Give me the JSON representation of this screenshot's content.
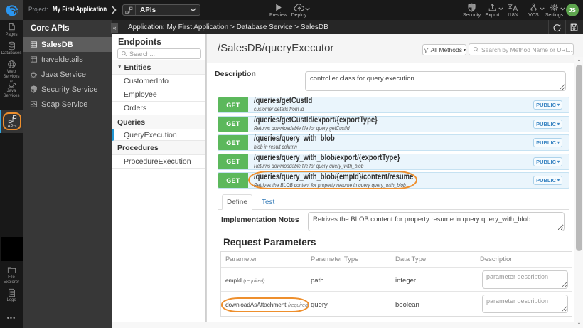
{
  "topbar": {
    "project_label": "Project:",
    "project_name": "My First Application",
    "selector_value": "APIs",
    "actions_left": [
      {
        "label": "Preview",
        "icon": "play-icon",
        "caret": false
      },
      {
        "label": "Deploy",
        "icon": "cloud-upload-icon",
        "caret": true
      }
    ],
    "actions_right": [
      {
        "label": "Security",
        "icon": "shield-icon",
        "caret": false
      },
      {
        "label": "Export",
        "icon": "export-icon",
        "caret": true
      },
      {
        "label": "I18N",
        "icon": "translate-icon",
        "caret": false
      },
      {
        "label": "VCS",
        "icon": "branch-icon",
        "caret": true
      },
      {
        "label": "Settings",
        "icon": "gear-icon",
        "caret": true
      }
    ],
    "avatar_initials": "JS"
  },
  "rail": {
    "top_items": [
      {
        "label": "Pages",
        "icon": "pages-icon",
        "active": false
      },
      {
        "label": "Databases",
        "icon": "database-icon",
        "active": false
      },
      {
        "label": "Web Services",
        "icon": "globe-icon",
        "active": false
      },
      {
        "label": "Java Services",
        "icon": "coffee-icon",
        "active": false
      },
      {
        "label": "APIs",
        "icon": "api-icon",
        "active": true
      }
    ],
    "bottom_items": [
      {
        "label": "File Explorer",
        "icon": "folder-icon"
      },
      {
        "label": "Logs",
        "icon": "logs-icon"
      }
    ],
    "more_label": "•••"
  },
  "core_apis": {
    "title": "Core APIs",
    "collapse_label": "«",
    "items": [
      {
        "label": "SalesDB",
        "icon": "table-icon",
        "selected": true
      },
      {
        "label": "traveldetails",
        "icon": "table-icon",
        "selected": false
      },
      {
        "label": "Java Service",
        "icon": "coffee-icon",
        "selected": false
      },
      {
        "label": "Security Service",
        "icon": "shield-icon",
        "selected": false
      },
      {
        "label": "Soap Service",
        "icon": "soap-icon",
        "selected": false
      }
    ]
  },
  "appbar": {
    "breadcrumb": "Application: My First Application > Database Service > SalesDB"
  },
  "endpoints": {
    "title": "Endpoints",
    "search_placeholder": "Search...",
    "rows": [
      {
        "type": "header",
        "label": "Entities",
        "arrow": true
      },
      {
        "type": "item",
        "label": "CustomerInfo",
        "selected": false
      },
      {
        "type": "item",
        "label": "Employee",
        "selected": false
      },
      {
        "type": "item",
        "label": "Orders",
        "selected": false
      },
      {
        "type": "header",
        "label": "Queries",
        "arrow": false
      },
      {
        "type": "item",
        "label": "QueryExecution",
        "selected": true
      },
      {
        "type": "header",
        "label": "Procedures",
        "arrow": false
      },
      {
        "type": "item",
        "label": "ProcedureExecution",
        "selected": false
      }
    ]
  },
  "main": {
    "title": "/SalesDB/queryExecutor",
    "filter_button_label": "All Methods",
    "search_placeholder": "Search by Method Name or URL...",
    "description_label": "Description",
    "description_value": "controller class for query execution",
    "methods": [
      {
        "verb": "GET",
        "path": "/queries/getCustId",
        "summary": "customer details from id",
        "visibility": "PUBLIC",
        "annotated": false
      },
      {
        "verb": "GET",
        "path": "/queries/getCustId/export/{exportType}",
        "summary": "Returns downloadable file for query getCustId",
        "visibility": "PUBLIC",
        "annotated": false
      },
      {
        "verb": "GET",
        "path": "/queries/query_with_blob",
        "summary": "blob in result column",
        "visibility": "PUBLIC",
        "annotated": false
      },
      {
        "verb": "GET",
        "path": "/queries/query_with_blob/export/{exportType}",
        "summary": "Returns downloadable file for query query_with_blob",
        "visibility": "PUBLIC",
        "annotated": false
      },
      {
        "verb": "GET",
        "path": "/queries/query_with_blob/{empId}/content/resume",
        "summary": "Retrives the BLOB content for property resume in query query_with_blob",
        "visibility": "PUBLIC",
        "annotated": true
      }
    ],
    "tabs": [
      {
        "label": "Define",
        "active": true
      },
      {
        "label": "Test",
        "active": false
      }
    ],
    "notes_label": "Implementation Notes",
    "notes_value": "Retrives the BLOB content for property resume in query query_with_blob",
    "request_parameters": {
      "title": "Request Parameters",
      "columns": [
        "Parameter",
        "Parameter Type",
        "Data Type",
        "Description"
      ],
      "rows": [
        {
          "name": "empId",
          "required_label": "(required)",
          "param_type": "path",
          "data_type": "integer",
          "description_placeholder": "parameter description",
          "annotated": false
        },
        {
          "name": "downloadAsAttachment",
          "required_label": "(required)",
          "param_type": "query",
          "data_type": "boolean",
          "description_placeholder": "parameter description",
          "annotated": true
        }
      ]
    }
  },
  "colors": {
    "accent_blue": "#2196d3",
    "get_green": "#5cb85c",
    "method_row_bg": "#eaf5fc",
    "annotation_orange": "#ee8f2d",
    "avatar_green": "#5ea54e",
    "link_blue": "#337ab7"
  }
}
